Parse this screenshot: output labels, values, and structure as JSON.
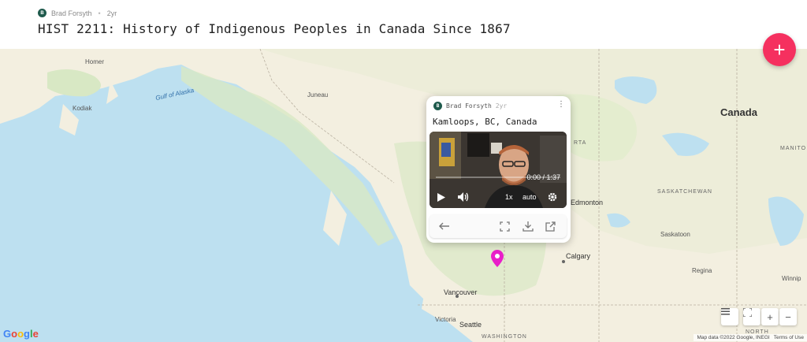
{
  "header": {
    "author": "Brad Forsyth",
    "author_initial": "B",
    "age": "2yr",
    "title": "HIST 2211: History of Indigenous Peoples in Canada Since 1867"
  },
  "fab": {
    "label": "+",
    "icon": "plus-icon",
    "color": "#f5305f"
  },
  "map": {
    "labels": {
      "homer": "Homer",
      "kodiak": "Kodiak",
      "gulf": "Gulf of Alaska",
      "juneau": "Juneau",
      "canada": "Canada",
      "manitoba": "MANITO",
      "saskatchewan": "SASKATCHEWAN",
      "alberta": "RTA",
      "edmonton": "Edmonton",
      "saskatoon": "Saskatoon",
      "calgary": "Calgary",
      "regina": "Regina",
      "winnipeg": "Winnip",
      "vancouver": "Vancouver",
      "victoria": "Victoria",
      "seattle": "Seattle",
      "washington": "WASHINGTON",
      "north": "NORTH"
    },
    "google_logo": "Google",
    "attribution": {
      "map_data": "Map data ©2022 Google, INEGI",
      "terms": "Terms of Use"
    },
    "controls": {
      "zoom_in": "+",
      "zoom_out": "−"
    },
    "colors": {
      "water": "#bde0f0",
      "land": "#f3efe0",
      "forest": "#d8e8c4",
      "pin": "#e91ec9"
    }
  },
  "popup": {
    "author": "Brad Forsyth",
    "author_initial": "B",
    "age": "2yr",
    "location": "Kamloops, BC, Canada",
    "video": {
      "time": "0:00 / 1:37",
      "speed": "1x",
      "quality": "auto"
    }
  }
}
